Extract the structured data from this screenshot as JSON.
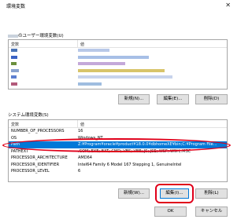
{
  "window": {
    "title": "環境変数"
  },
  "user_vars": {
    "label": "のユーザー環境変数(U)",
    "header": {
      "name": "変数",
      "value": "値"
    },
    "rows": [
      {
        "name": "",
        "value": ""
      },
      {
        "name": "",
        "value": ""
      },
      {
        "name": "",
        "value": ""
      },
      {
        "name": "",
        "value": ""
      },
      {
        "name": "",
        "value": ""
      },
      {
        "name": "",
        "value": ""
      },
      {
        "name": "",
        "value": ""
      }
    ],
    "buttons": {
      "new": "新規(N)...",
      "edit": "編集(E)...",
      "delete": "削除(D)"
    }
  },
  "system_vars": {
    "label": "システム環境変数(S)",
    "header": {
      "name": "変数",
      "value": "値"
    },
    "rows": [
      {
        "name": "NUMBER_OF_PROCESSORS",
        "value": "16"
      },
      {
        "name": "OS",
        "value": "Windows_NT"
      },
      {
        "name": "Path",
        "value": "Z:¥Program¥oracle¥product¥18.0.0¥dbhomeXE¥bin;C:¥Program File...",
        "selected": true
      },
      {
        "name": "PATHEXT",
        "value": ".COM;.EXE;.BAT;.CMD;.VBS;.VBE;.JS;.JSE;.WSF;.WSH;.MSC"
      },
      {
        "name": "PROCESSOR_ARCHITECTURE",
        "value": "AMD64"
      },
      {
        "name": "PROCESSOR_IDENTIFIER",
        "value": "Intel64 Family 6 Model 167 Stepping 1, GenuineIntel"
      },
      {
        "name": "PROCESSOR_LEVEL",
        "value": "6"
      }
    ],
    "buttons": {
      "new": "新規(W)...",
      "edit": "編集(I)...",
      "delete": "削除(L)"
    }
  },
  "footer": {
    "ok": "OK",
    "cancel": "キャンセル"
  },
  "colors": {
    "selection": "#0078d7",
    "highlight": "#e0001a"
  }
}
